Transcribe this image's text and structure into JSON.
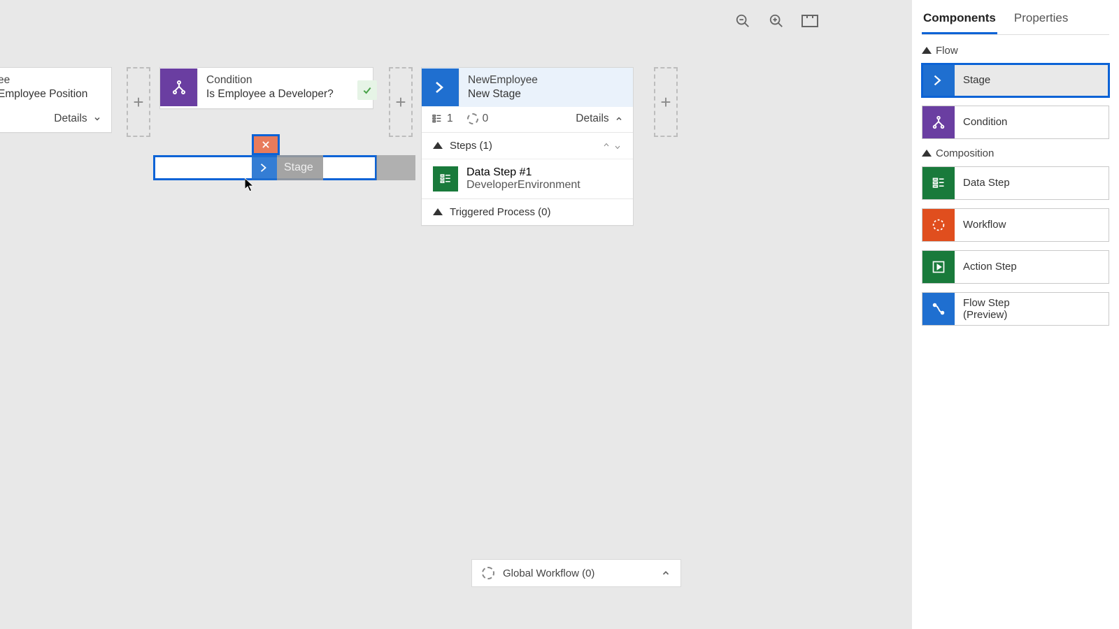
{
  "toolbar": {},
  "panel": {
    "tabs": {
      "components": "Components",
      "properties": "Properties"
    },
    "sections": {
      "flow": "Flow",
      "composition": "Composition"
    },
    "items": {
      "stage": "Stage",
      "condition": "Condition",
      "datastep": "Data Step",
      "workflow": "Workflow",
      "actionstep": "Action Step",
      "flowstep_l1": "Flow Step",
      "flowstep_l2": "(Preview)"
    }
  },
  "canvas": {
    "partial_stage": {
      "title": "ee",
      "sub": "Employee Position",
      "details": "Details"
    },
    "condition": {
      "title": "Condition",
      "sub": "Is Employee a Developer?"
    },
    "drag_ghost": {
      "label": "Stage"
    },
    "stage": {
      "title": "NewEmployee",
      "sub": "New Stage",
      "metric1": "1",
      "metric2": "0",
      "details": "Details",
      "steps_header": "Steps (1)",
      "step1_title": "Data Step #1",
      "step1_sub": "DeveloperEnvironment",
      "triggered": "Triggered Process (0)"
    },
    "global_workflow": "Global Workflow (0)"
  }
}
